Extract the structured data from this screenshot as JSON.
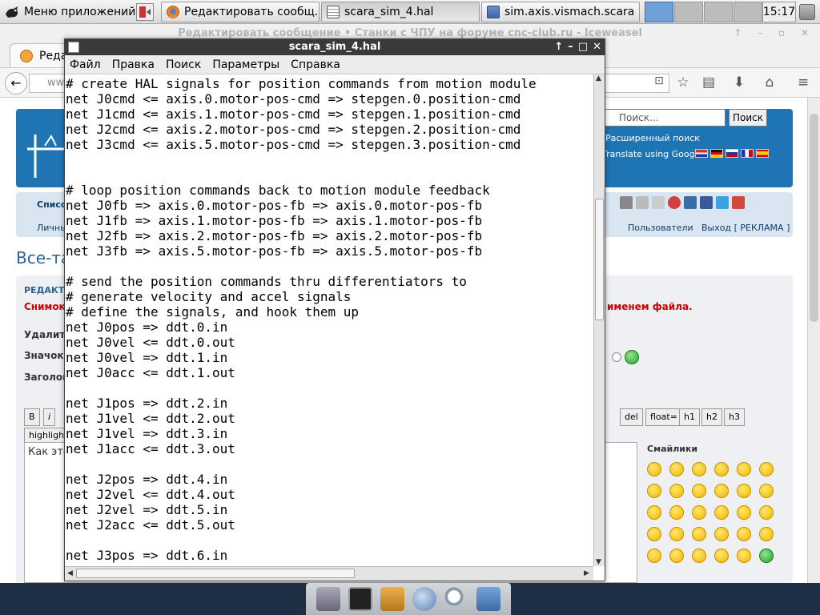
{
  "top_panel": {
    "apps_menu_label": "Меню приложений",
    "tasks": [
      {
        "label": "Редактировать сообщ...",
        "icon": "firefox-icon"
      },
      {
        "label": "scara_sim_4.hal",
        "icon": "text-editor-icon"
      },
      {
        "label": "sim.axis.vismach.scara ...",
        "icon": "folder-icon"
      }
    ],
    "clock": "15:17"
  },
  "browser": {
    "title": "Редактировать сообщение • Станки с ЧПУ на форуме cnc-club.ru - Iceweasel",
    "tab_label": "Реда",
    "url_prefix": "ww",
    "search_placeholder": "Поиск...",
    "search_button": "Поиск",
    "advanced_search": "Расширенный поиск",
    "translate_label": "Translate using Google:",
    "menu_list": "Списо",
    "menu_personal": "Личны",
    "menu_users": "Пользователи",
    "menu_logout": "Выход [ РЕКЛАМА ]",
    "page_heading": "Все-та",
    "edit_label": "РЕДАКТ",
    "red_note_left": "Снимок",
    "red_note_right": "именем файла.",
    "delete_label": "Удалить",
    "icon_label": "Значок:",
    "subject_label": "Заголово",
    "textarea_text": "Как это",
    "format_buttons": [
      "B",
      "i",
      "del",
      "float=",
      "h1",
      "h2",
      "h3"
    ],
    "highlight_label": "highlight=",
    "smileys_title": "Смайлики"
  },
  "editor": {
    "title": "scara_sim_4.hal",
    "menu": [
      "Файл",
      "Правка",
      "Поиск",
      "Параметры",
      "Справка"
    ],
    "lines": [
      "# create HAL signals for position commands from motion module",
      "net J0cmd <= axis.0.motor-pos-cmd => stepgen.0.position-cmd",
      "net J1cmd <= axis.1.motor-pos-cmd => stepgen.1.position-cmd",
      "net J2cmd <= axis.2.motor-pos-cmd => stepgen.2.position-cmd",
      "net J3cmd <= axis.5.motor-pos-cmd => stepgen.3.position-cmd",
      "",
      "",
      "# loop position commands back to motion module feedback",
      "net J0fb => axis.0.motor-pos-fb => axis.0.motor-pos-fb",
      "net J1fb => axis.1.motor-pos-fb => axis.1.motor-pos-fb",
      "net J2fb => axis.2.motor-pos-fb => axis.2.motor-pos-fb",
      "net J3fb => axis.5.motor-pos-fb => axis.5.motor-pos-fb",
      "",
      "# send the position commands thru differentiators to",
      "# generate velocity and accel signals",
      "# define the signals, and hook them up",
      "net J0pos => ddt.0.in",
      "net J0vel <= ddt.0.out",
      "net J0vel => ddt.1.in",
      "net J0acc <= ddt.1.out",
      "",
      "net J1pos => ddt.2.in",
      "net J1vel <= ddt.2.out",
      "net J1vel => ddt.3.in",
      "net J1acc <= ddt.3.out",
      "",
      "net J2pos => ddt.4.in",
      "net J2vel <= ddt.4.out",
      "net J2vel => ddt.5.in",
      "net J2acc <= ddt.5.out",
      "",
      "net J3pos => ddt.6.in"
    ]
  }
}
